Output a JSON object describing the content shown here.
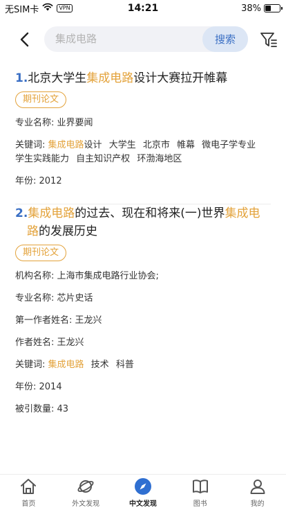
{
  "status_bar": {
    "carrier": "无SIM卡",
    "vpn": "VPN",
    "time": "14:21",
    "battery": "38%",
    "battery_level": 0.38
  },
  "search": {
    "placeholder": "集成电路",
    "button_label": "搜索"
  },
  "results": [
    {
      "number": "1.",
      "title_parts": [
        {
          "text": "北京大学生",
          "hl": false
        },
        {
          "text": "集成电路",
          "hl": true
        },
        {
          "text": "设计大赛拉开帷幕",
          "hl": false
        }
      ],
      "tag": "期刊论文",
      "fields": [
        {
          "label": "专业名称: ",
          "value": "业界要闻"
        }
      ],
      "keywords_label": "关键词: ",
      "keywords": [
        {
          "text": "集成电路",
          "hl": true,
          "suffix": "设计"
        },
        {
          "text": "大学生",
          "hl": false
        },
        {
          "text": "北京市",
          "hl": false
        },
        {
          "text": "帷幕",
          "hl": false
        },
        {
          "text": "微电子学专业",
          "hl": false
        },
        {
          "text": "学生实践能力",
          "hl": false
        },
        {
          "text": "自主知识产权",
          "hl": false
        },
        {
          "text": "环渤海地区",
          "hl": false
        }
      ],
      "after_fields": [
        {
          "label": "年份: ",
          "value": "2012"
        }
      ]
    },
    {
      "number": "2.",
      "title_parts": [
        {
          "text": "集成电路",
          "hl": true
        },
        {
          "text": "的过去、现在和将来(一)世界",
          "hl": false
        },
        {
          "text": "集成电路",
          "hl": true
        },
        {
          "text": "的发展历史",
          "hl": false
        }
      ],
      "tag": "期刊论文",
      "fields": [
        {
          "label": "机构名称: ",
          "value": "上海市集成电路行业协会;"
        },
        {
          "label": "专业名称: ",
          "value": "芯片史话"
        },
        {
          "label": "第一作者姓名: ",
          "value": "王龙兴"
        },
        {
          "label": "作者姓名: ",
          "value": "王龙兴"
        }
      ],
      "keywords_label": "关键词: ",
      "keywords": [
        {
          "text": "集成电路",
          "hl": true
        },
        {
          "text": "技术",
          "hl": false
        },
        {
          "text": "科普",
          "hl": false
        }
      ],
      "after_fields": [
        {
          "label": "年份: ",
          "value": "2014"
        },
        {
          "label": "被引数量: ",
          "value": "43"
        }
      ]
    }
  ],
  "tabs": [
    {
      "label": "首页",
      "icon": "home-icon",
      "active": false
    },
    {
      "label": "外文发现",
      "icon": "planet-icon",
      "active": false
    },
    {
      "label": "中文发现",
      "icon": "compass-icon",
      "active": true
    },
    {
      "label": "图书",
      "icon": "book-icon",
      "active": false
    },
    {
      "label": "我的",
      "icon": "user-icon",
      "active": false
    }
  ],
  "colors": {
    "highlight": "#e3a23a",
    "accent": "#3a6fc4",
    "search_bg": "#f1f2f6",
    "search_btn_bg": "#dce6f5"
  }
}
